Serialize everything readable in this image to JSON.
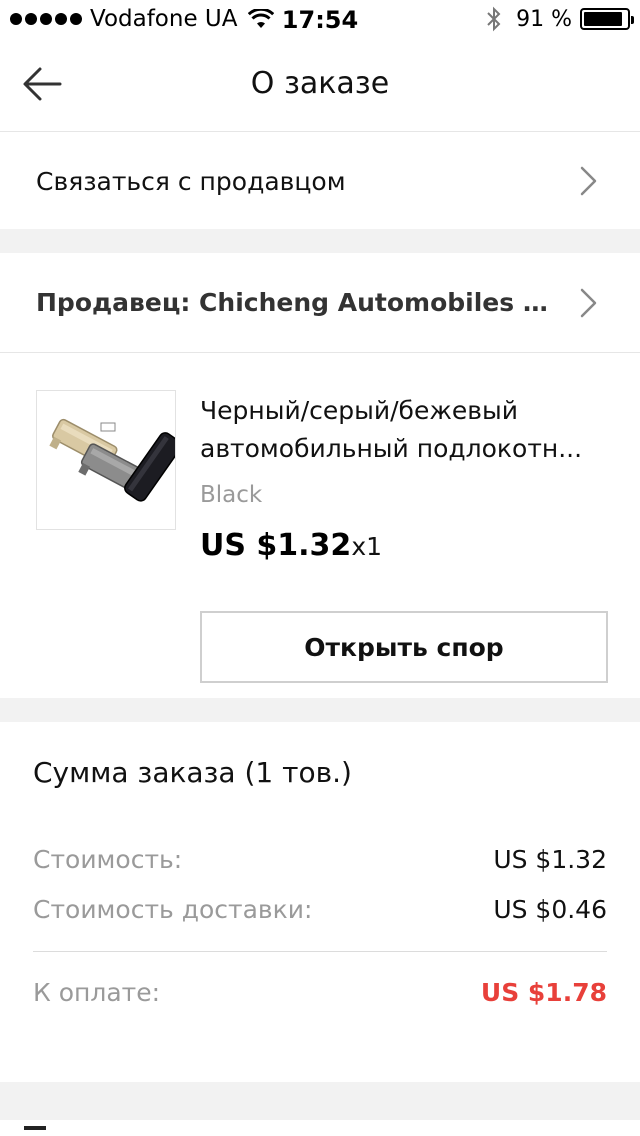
{
  "status_bar": {
    "carrier": "Vodafone UA",
    "time": "17:54",
    "battery_percent": "91 %",
    "battery_level": 0.91
  },
  "nav": {
    "title": "О заказе"
  },
  "contact": {
    "label": "Связаться с продавцом"
  },
  "seller": {
    "label": "Продавец: Chicheng Automobiles &..."
  },
  "product": {
    "title_line1": "Черный/серый/бежевый",
    "title_line2": "автомобильный подлокотн...",
    "variant": "Black",
    "price": "US $1.32",
    "quantity": "x1",
    "dispute_button": "Открыть спор"
  },
  "summary": {
    "title": "Сумма заказа (1 тов.)",
    "rows": [
      {
        "label": "Стоимость:",
        "value": "US $1.32"
      },
      {
        "label": "Стоимость доставки:",
        "value": "US $0.46"
      }
    ],
    "total": {
      "label": "К оплате:",
      "value": "US $1.78"
    },
    "total_color": "#e8403a"
  },
  "icons": {
    "back": "arrow-left-icon",
    "chevron": "chevron-right-icon",
    "wifi": "wifi-icon",
    "bluetooth": "bluetooth-icon",
    "battery": "battery-icon"
  }
}
